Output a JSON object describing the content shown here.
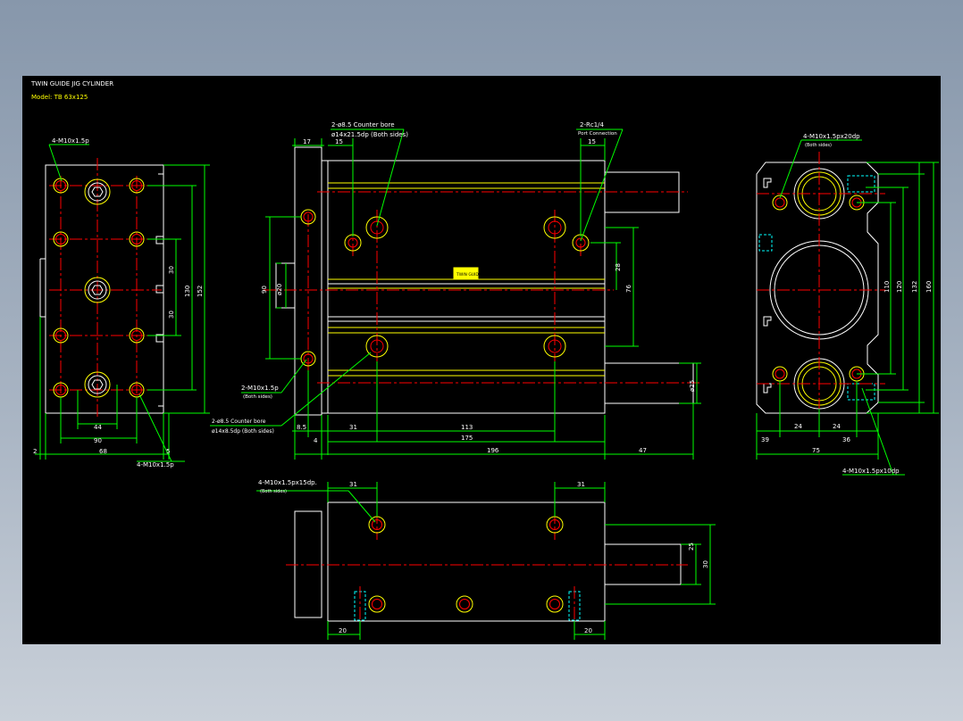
{
  "title": {
    "line1": "TWIN GUIDE JIG CYLINDER",
    "line2": "Model: TB 63x125"
  },
  "colors": {
    "background": "#000000",
    "outline": "#ffffff",
    "dimension": "#00ff00",
    "centerline": "#ff0000",
    "hidden": "#00ffff",
    "thread": "#ffff00",
    "label": "#ffffff"
  },
  "left_view": {
    "callout_top": "4-M10x1.5p",
    "callout_bottom": "4-M10x1.5p",
    "dims": {
      "d30_upper": "30",
      "d30_lower": "30",
      "d130": "130",
      "d152": "152",
      "d44": "44",
      "d90": "90",
      "d2": "2",
      "d68": "68",
      "d5": "5"
    }
  },
  "front_view": {
    "callout_cbore_top_1": "2-ø8.5 Counter bore",
    "callout_cbore_top_2": "ø14x21.5dp (Both sides)",
    "callout_port_1": "2-Rc1/4",
    "callout_port_2": "Port Connection",
    "callout_tap_1": "2-M10x1.5p",
    "callout_tap_2": "(Both sides)",
    "callout_cbore_bot_1": "2-ø8.5 Counter bore",
    "callout_cbore_bot_2": "ø14x8.5dp (Both sides)",
    "nameplate": "TWIN GUIDE",
    "dims": {
      "d17": "17",
      "d15_left": "15",
      "d15_right": "15",
      "d90": "90",
      "d20": "ø20",
      "d28": "28",
      "d76": "76",
      "d25": "ø25",
      "d8_5": "8.5",
      "d4": "4",
      "d31": "31",
      "d113": "113",
      "d175": "175",
      "d196": "196",
      "d47": "47"
    }
  },
  "right_view": {
    "callout_top_1": "4-M10x1.5px20dp",
    "callout_top_2": "(Both sides)",
    "callout_bottom": "4-M10x1.5px10dp",
    "dims": {
      "d110": "110",
      "d120": "120",
      "d132": "132",
      "d160": "160",
      "d39": "39",
      "d24_left": "24",
      "d24_right": "24",
      "d36": "36",
      "d75": "75"
    }
  },
  "bottom_view": {
    "callout_1": "4-M10x1.5px15dp.",
    "callout_2": "(Both sides)",
    "dims": {
      "d31_left": "31",
      "d31_right": "31",
      "d25": "25",
      "d30": "30",
      "d20_left": "20",
      "d20_right": "20"
    }
  }
}
